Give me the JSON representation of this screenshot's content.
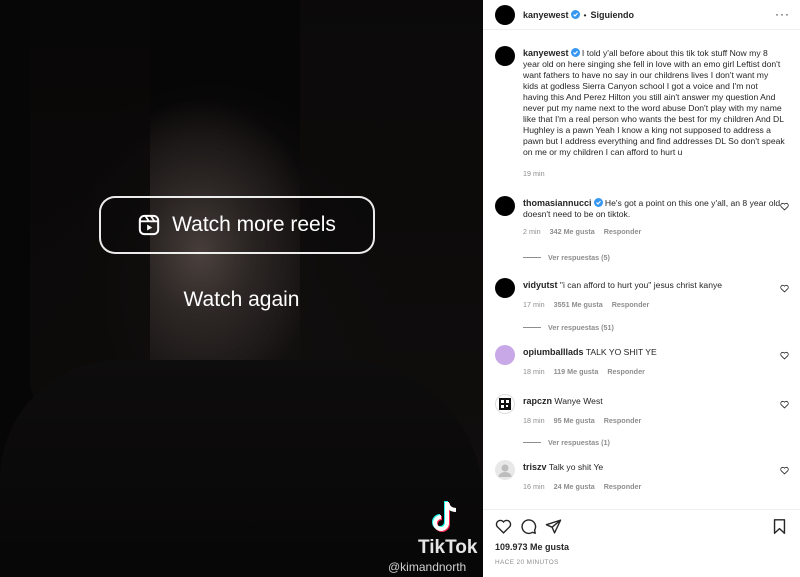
{
  "video": {
    "watch_more_label": "Watch more reels",
    "watch_again_label": "Watch again",
    "tiktok_word": "TikTok",
    "tiktok_handle": "@kimandnorth"
  },
  "header": {
    "username": "kanyewest",
    "separator": "•",
    "following_label": "Siguiendo",
    "more_label": "···"
  },
  "caption": {
    "username": "kanyewest",
    "text": "I told y'all before about this tik tok stuff Now my 8 year old on here singing she fell in love with an emo girl Leftist don't want fathers to have no say in our childrens lives I don't want my kids at godless Sierra Canyon school I got a voice and I'm not having this And Perez Hilton you still ain't answer my question And never put my name next to the word abuse Don't play with my name like that I'm a real person who wants the best for my children And DL Hughley is a pawn Yeah I know a king not supposed to address a pawn but I address everything and find addresses DL So don't speak on me or my children I can afford to hurt u",
    "time": "19 min"
  },
  "comments": [
    {
      "username": "thomasiannucci",
      "text": "He's got a point on this one y'all, an 8 year old doesn't need to be on tiktok.",
      "time": "2 min",
      "likes": "342 Me gusta",
      "reply": "Responder",
      "view_replies": "Ver respuestas (5)",
      "avatar_color": "#000000"
    },
    {
      "username": "vidyutst",
      "text": "\"i can afford to hurt you\" jesus christ kanye",
      "time": "17 min",
      "likes": "3551 Me gusta",
      "reply": "Responder",
      "view_replies": "Ver respuestas (51)",
      "avatar_color": "#000000"
    },
    {
      "username": "opiumballlads",
      "text": "TALK YO SHIT YE",
      "time": "18 min",
      "likes": "119 Me gusta",
      "reply": "Responder",
      "view_replies": "",
      "avatar_color": "#c9a8e8"
    },
    {
      "username": "rapczn",
      "text": "Wanye West",
      "time": "18 min",
      "likes": "95 Me gusta",
      "reply": "Responder",
      "view_replies": "Ver respuestas (1)",
      "avatar_color": "#111111"
    },
    {
      "username": "triszv",
      "text": "Talk yo shit Ye",
      "time": "16 min",
      "likes": "24 Me gusta",
      "reply": "Responder",
      "view_replies": "",
      "avatar_color": "#e8e8e8"
    }
  ],
  "post": {
    "likes_total": "109.973 Me gusta",
    "time_ago": "HACE 20 MINUTOS"
  },
  "icons": {
    "verified_color": "#3897f0",
    "like": "heart-icon",
    "comment": "comment-icon",
    "share": "share-icon",
    "save": "bookmark-icon"
  }
}
